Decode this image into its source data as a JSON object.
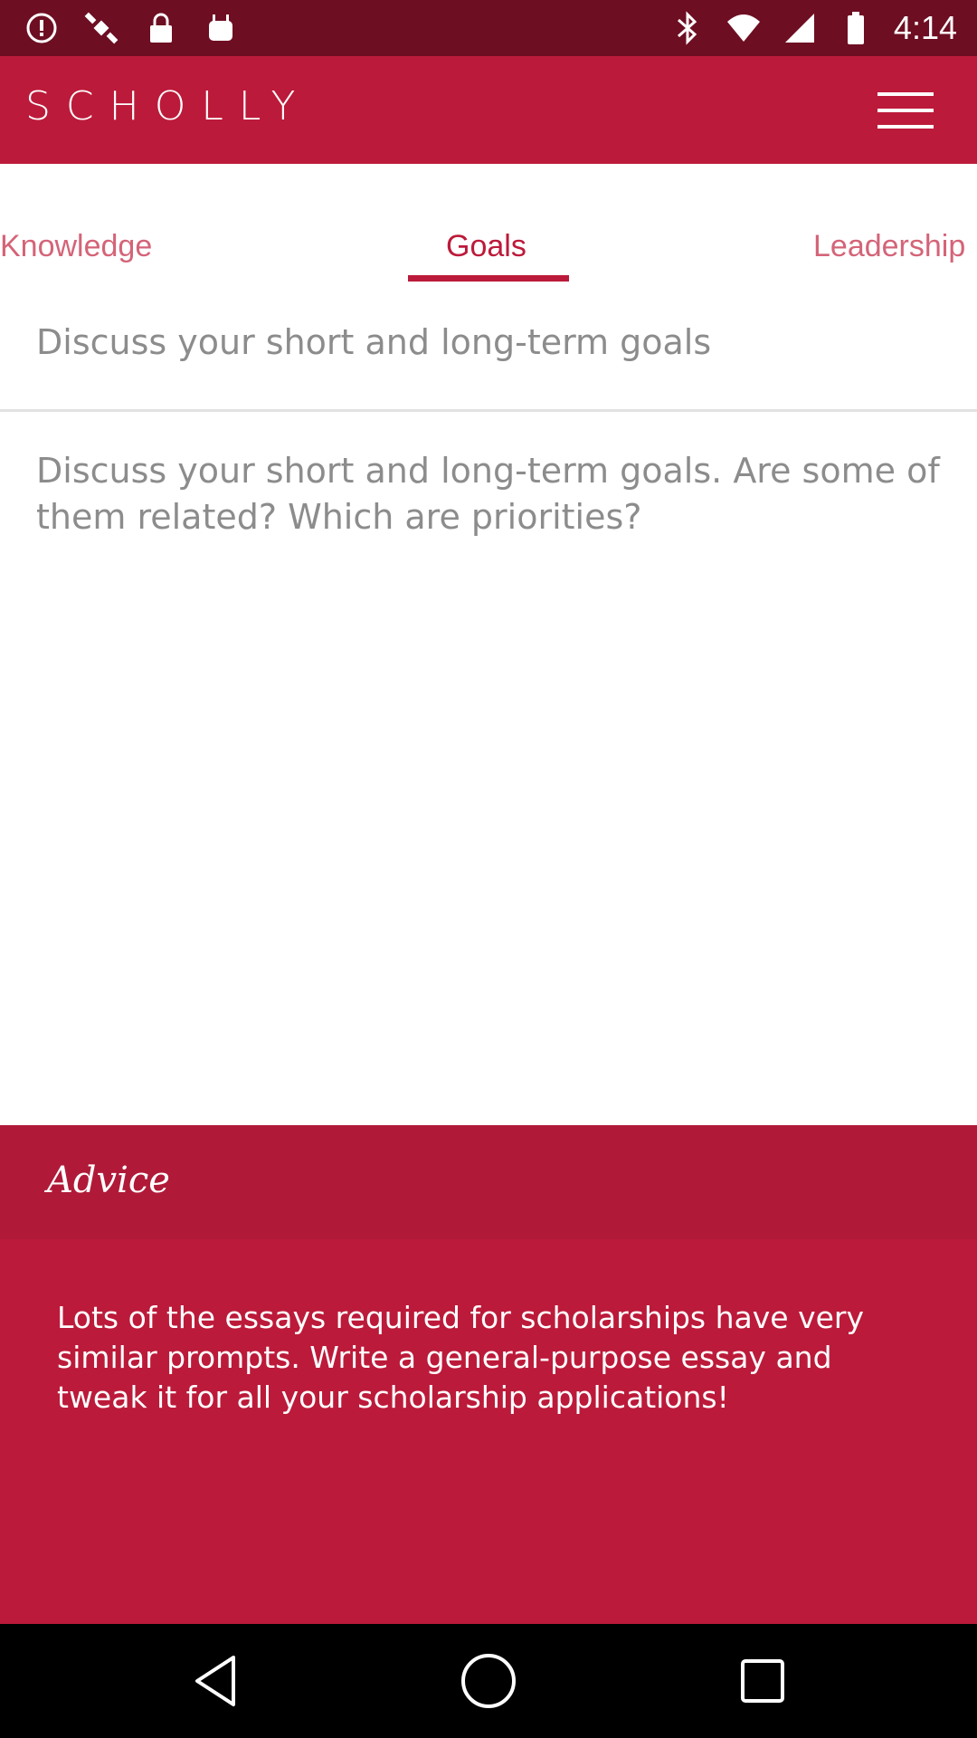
{
  "status_bar": {
    "time": "4:14",
    "left_icons": [
      "alert-icon",
      "satellite-icon",
      "lock-icon",
      "android-icon"
    ],
    "right_icons": [
      "bluetooth-icon",
      "wifi-icon",
      "signal-icon",
      "battery-icon"
    ]
  },
  "app_bar": {
    "title": "SCHOLLY",
    "menu_icon": "hamburger-menu-icon"
  },
  "tabs": [
    {
      "label": "Knowledge",
      "active": false
    },
    {
      "label": "Goals",
      "active": true
    },
    {
      "label": "Leadership",
      "active": false
    }
  ],
  "prompt": {
    "title": "Discuss your short and long-term goals",
    "body": "Discuss your short and long-term goals. Are some of them related? Which are priorities?"
  },
  "advice": {
    "title": "Advice",
    "text": "Lots of the essays required for scholarships have very similar prompts. Write a general-purpose essay and tweak it for all your scholarship applications!"
  },
  "nav_bar": {
    "buttons": [
      "back-icon",
      "home-icon",
      "recents-icon"
    ]
  },
  "colors": {
    "status_bar": "#6e0e22",
    "brand": "#bc1a3a",
    "advice_header": "#b01a38",
    "tab_inactive": "#d46478",
    "prompt_text": "#8c8c8c"
  }
}
